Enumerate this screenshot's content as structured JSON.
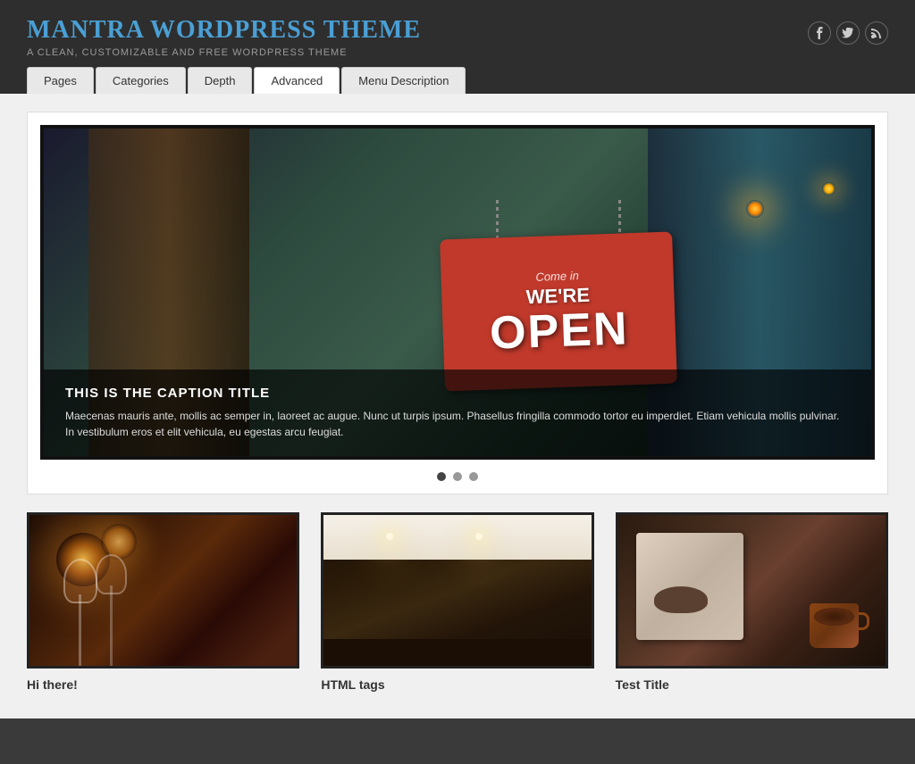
{
  "header": {
    "site_title": "Mantra WordPress Theme",
    "site_subtitle": "A Clean, Customizable and Free WordPress Theme",
    "social_icons": [
      {
        "name": "facebook",
        "symbol": "f"
      },
      {
        "name": "twitter",
        "symbol": "t"
      },
      {
        "name": "rss",
        "symbol": "r"
      }
    ]
  },
  "nav": {
    "tabs": [
      {
        "id": "pages",
        "label": "Pages",
        "active": false
      },
      {
        "id": "categories",
        "label": "Categories",
        "active": false
      },
      {
        "id": "depth",
        "label": "Depth",
        "active": false
      },
      {
        "id": "advanced",
        "label": "Advanced",
        "active": true
      },
      {
        "id": "menu-description",
        "label": "Menu Description",
        "active": false
      }
    ]
  },
  "slider": {
    "caption_title": "This is the Caption Title",
    "caption_text": "Maecenas mauris ante, mollis ac semper in, laoreet ac augue. Nunc ut turpis ipsum. Phasellus fringilla commodo tortor eu imperdiet. Etiam vehicula mollis pulvinar. In vestibulum eros et elit vehicula, eu egestas arcu feugiat.",
    "dots": [
      {
        "active": true
      },
      {
        "active": false
      },
      {
        "active": false
      }
    ]
  },
  "posts": [
    {
      "id": "post-1",
      "title": "Hi there!",
      "image_alt": "Wine glasses with warm light"
    },
    {
      "id": "post-2",
      "title": "HTML tags",
      "image_alt": "Restaurant interior with tables"
    },
    {
      "id": "post-3",
      "title": "Test Title",
      "image_alt": "Espresso machine with coffee cup"
    }
  ],
  "colors": {
    "accent_blue": "#4a9fd4",
    "header_bg": "#2e2e2e",
    "page_bg": "#3a3a3a"
  }
}
